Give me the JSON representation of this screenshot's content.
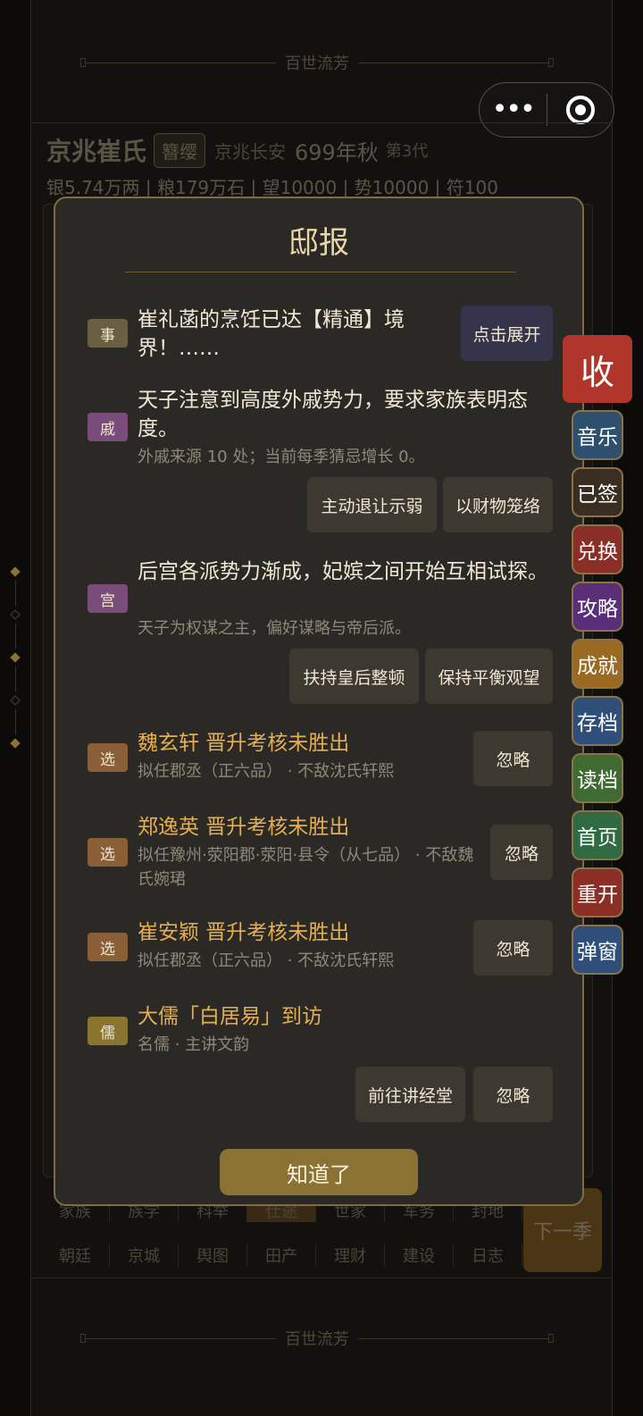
{
  "game_title": "百世流芳",
  "family": {
    "name": "京兆崔氏",
    "rank": "簪缨",
    "location": "京兆长安",
    "year": "699年秋",
    "generation": "第3代",
    "stats": "银5.74万两 | 粮179万石 | 望10000 | 势10000 | 符100"
  },
  "bottom_nav": {
    "row1": [
      "家族",
      "族学",
      "科举",
      "仕途",
      "世家",
      "军务",
      "封地"
    ],
    "row2": [
      "朝廷",
      "京城",
      "舆图",
      "田产",
      "理财",
      "建设",
      "日志"
    ],
    "next": "下一季"
  },
  "modal": {
    "title": "邸报",
    "items": [
      {
        "badge": "事",
        "title": "崔礼菡的烹饪已达【精通】境界！……",
        "actions": [
          "点击展开"
        ]
      },
      {
        "badge": "戚",
        "title": "天子注意到高度外戚势力，要求家族表明态度。",
        "sub": "外戚来源 10 处；当前每季猜忌增长 0。",
        "actions": [
          "主动退让示弱",
          "以财物笼络"
        ]
      },
      {
        "badge": "宫",
        "title": "后宫各派势力渐成，妃嫔之间开始互相试探。",
        "sub": "天子为权谋之主，偏好谋略与帝后派。",
        "actions": [
          "扶持皇后整顿",
          "保持平衡观望"
        ]
      },
      {
        "badge": "选",
        "title": "魏玄轩 晋升考核未胜出",
        "sub": "拟任郡丞（正六品） · 不敌沈氏轩熙",
        "actions": [
          "忽略"
        ]
      },
      {
        "badge": "选",
        "title": "郑逸英 晋升考核未胜出",
        "sub": "拟任豫州·荥阳郡·荥阳·县令（从七品） · 不敌魏氏婉珺",
        "actions": [
          "忽略"
        ]
      },
      {
        "badge": "选",
        "title": "崔安颖 晋升考核未胜出",
        "sub": "拟任郡丞（正六品） · 不敌沈氏轩熙",
        "actions": [
          "忽略"
        ]
      },
      {
        "badge": "儒",
        "title": "大儒「白居易」到访",
        "sub": "名儒 · 主讲文韵",
        "actions": [
          "前往讲经堂",
          "忽略"
        ]
      }
    ],
    "confirm": "知道了"
  },
  "float_menu": {
    "collapse": "收",
    "items": [
      {
        "label": "音乐",
        "color": "#2f4f6e"
      },
      {
        "label": "已签",
        "color": "#3a2e22"
      },
      {
        "label": "兑换",
        "color": "#8a2e26"
      },
      {
        "label": "攻略",
        "color": "#5a2f78"
      },
      {
        "label": "成就",
        "color": "#9a6a22"
      },
      {
        "label": "存档",
        "color": "#2f4f7a"
      },
      {
        "label": "读档",
        "color": "#3f6a32"
      },
      {
        "label": "首页",
        "color": "#2f6a42"
      },
      {
        "label": "重开",
        "color": "#8a2e26"
      },
      {
        "label": "弹窗",
        "color": "#2f4f7a"
      }
    ]
  }
}
